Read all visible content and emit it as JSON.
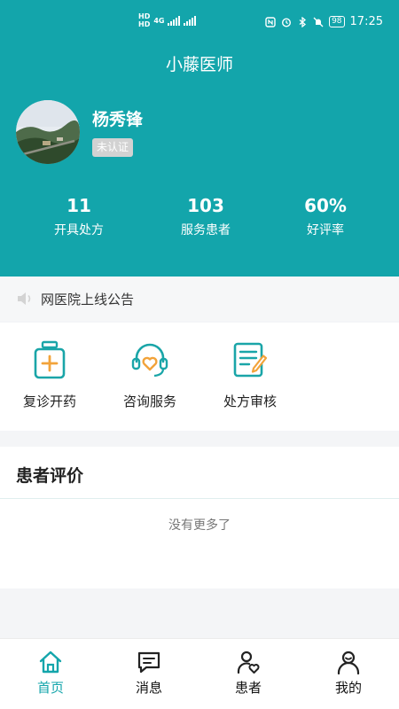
{
  "status_bar": {
    "hd_label": "HD",
    "signal": "4G",
    "battery": "98",
    "time": "17:25"
  },
  "app_title": "小藤医师",
  "doctor": {
    "name": "杨秀锋",
    "verification_status": "未认证"
  },
  "stats": [
    {
      "value": "11",
      "label": "开具处方"
    },
    {
      "value": "103",
      "label": "服务患者"
    },
    {
      "value": "60%",
      "label": "好评率"
    }
  ],
  "notice": {
    "text": "网医院上线公告",
    "icon": "speaker-icon"
  },
  "services": [
    {
      "label": "复诊开药",
      "icon": "medicine-bottle-icon"
    },
    {
      "label": "咨询服务",
      "icon": "headset-heart-icon"
    },
    {
      "label": "处方审核",
      "icon": "prescription-review-icon"
    }
  ],
  "reviews": {
    "title": "患者评价",
    "empty_text": "没有更多了"
  },
  "tabs": [
    {
      "label": "首页",
      "icon": "home-icon",
      "active": true
    },
    {
      "label": "消息",
      "icon": "message-icon",
      "active": false
    },
    {
      "label": "患者",
      "icon": "patient-icon",
      "active": false
    },
    {
      "label": "我的",
      "icon": "profile-icon",
      "active": false
    }
  ],
  "colors": {
    "primary": "#13a5ab",
    "service_icon_teal": "#1aa5a8",
    "service_icon_orange": "#f2a33a"
  }
}
